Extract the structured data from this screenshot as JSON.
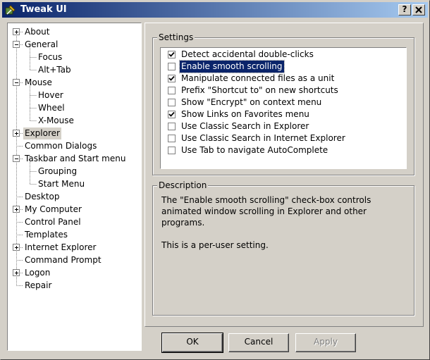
{
  "window": {
    "title": "Tweak UI",
    "help_glyph": "?",
    "close_glyph": "✕"
  },
  "tree": {
    "items": [
      {
        "label": "About",
        "level": 0,
        "expander": "+"
      },
      {
        "label": "General",
        "level": 0,
        "expander": "-"
      },
      {
        "label": "Focus",
        "level": 1,
        "expander": ""
      },
      {
        "label": "Alt+Tab",
        "level": 1,
        "expander": ""
      },
      {
        "label": "Mouse",
        "level": 0,
        "expander": "-"
      },
      {
        "label": "Hover",
        "level": 1,
        "expander": ""
      },
      {
        "label": "Wheel",
        "level": 1,
        "expander": ""
      },
      {
        "label": "X-Mouse",
        "level": 1,
        "expander": ""
      },
      {
        "label": "Explorer",
        "level": 0,
        "expander": "+",
        "selected": true
      },
      {
        "label": "Common Dialogs",
        "level": 0,
        "expander": ""
      },
      {
        "label": "Taskbar and Start menu",
        "level": 0,
        "expander": "-"
      },
      {
        "label": "Grouping",
        "level": 1,
        "expander": ""
      },
      {
        "label": "Start Menu",
        "level": 1,
        "expander": ""
      },
      {
        "label": "Desktop",
        "level": 0,
        "expander": ""
      },
      {
        "label": "My Computer",
        "level": 0,
        "expander": "+"
      },
      {
        "label": "Control Panel",
        "level": 0,
        "expander": ""
      },
      {
        "label": "Templates",
        "level": 0,
        "expander": ""
      },
      {
        "label": "Internet Explorer",
        "level": 0,
        "expander": "+"
      },
      {
        "label": "Command Prompt",
        "level": 0,
        "expander": ""
      },
      {
        "label": "Logon",
        "level": 0,
        "expander": "+"
      },
      {
        "label": "Repair",
        "level": 0,
        "expander": ""
      }
    ]
  },
  "settings": {
    "title": "Settings",
    "items": [
      {
        "label": "Detect accidental double-clicks",
        "checked": true
      },
      {
        "label": "Enable smooth scrolling",
        "checked": false,
        "selected": true
      },
      {
        "label": "Manipulate connected files as a unit",
        "checked": true
      },
      {
        "label": "Prefix \"Shortcut to\" on new shortcuts",
        "checked": false
      },
      {
        "label": "Show \"Encrypt\" on context menu",
        "checked": false
      },
      {
        "label": "Show Links on Favorites menu",
        "checked": true
      },
      {
        "label": "Use Classic Search in Explorer",
        "checked": false
      },
      {
        "label": "Use Classic Search in Internet Explorer",
        "checked": false
      },
      {
        "label": "Use Tab to navigate AutoComplete",
        "checked": false
      }
    ]
  },
  "description": {
    "title": "Description",
    "text": "The \"Enable smooth scrolling\" check-box controls animated window scrolling in Explorer and other programs.\n\nThis is a per-user setting."
  },
  "buttons": {
    "ok": "OK",
    "cancel": "Cancel",
    "apply": "Apply"
  }
}
